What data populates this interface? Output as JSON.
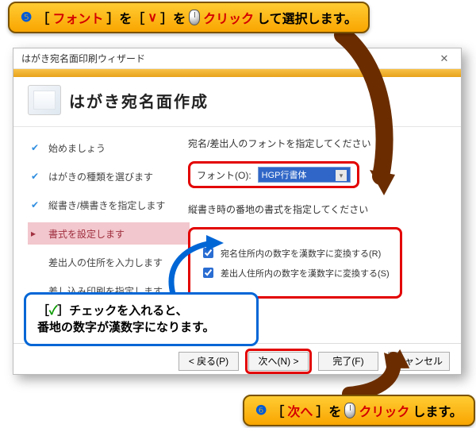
{
  "callouts": {
    "top": {
      "num": "❺",
      "seg1": "［",
      "seg2": "フォント",
      "seg3": "］を［",
      "seg4": "∨",
      "seg5": "］を",
      "seg6_after_mouse": "クリック",
      "seg7": "して選択します。"
    },
    "bottom": {
      "num": "❻",
      "seg1": "［",
      "seg2": "次へ",
      "seg3": "］を",
      "seg4_after_mouse": "クリック",
      "seg5": "します。"
    }
  },
  "dialog": {
    "title": "はがき宛名面印刷ウィザード",
    "header": "はがき宛名面作成",
    "steps": [
      {
        "label": "始めましょう",
        "state": "done"
      },
      {
        "label": "はがきの種類を選びます",
        "state": "done"
      },
      {
        "label": "縦書き/横書きを指定します",
        "state": "done"
      },
      {
        "label": "書式を設定します",
        "state": "active"
      },
      {
        "label": "差出人の住所を入力します",
        "state": "future"
      },
      {
        "label": "差し込み印刷を指定します",
        "state": "future"
      }
    ],
    "right": {
      "font_caption": "宛名/差出人のフォントを指定してください",
      "font_label": "フォント(O):",
      "font_value": "HGP行書体",
      "vert_caption": "縦書き時の番地の書式を指定してください",
      "chk1": "宛名住所内の数字を漢数字に変換する(R)",
      "chk2": "差出人住所内の数字を漢数字に変換する(S)",
      "chk1_checked": true,
      "chk2_checked": true
    },
    "buttons": {
      "back": "< 戻る(P)",
      "next": "次へ(N) >",
      "finish": "完了(F)",
      "cancel": "キャンセル"
    }
  },
  "note": {
    "line1_pre": "［",
    "line1_mark": "✓",
    "line1_post": "］チェックを入れると、",
    "line2": "番地の数字が漢数字になります。"
  }
}
